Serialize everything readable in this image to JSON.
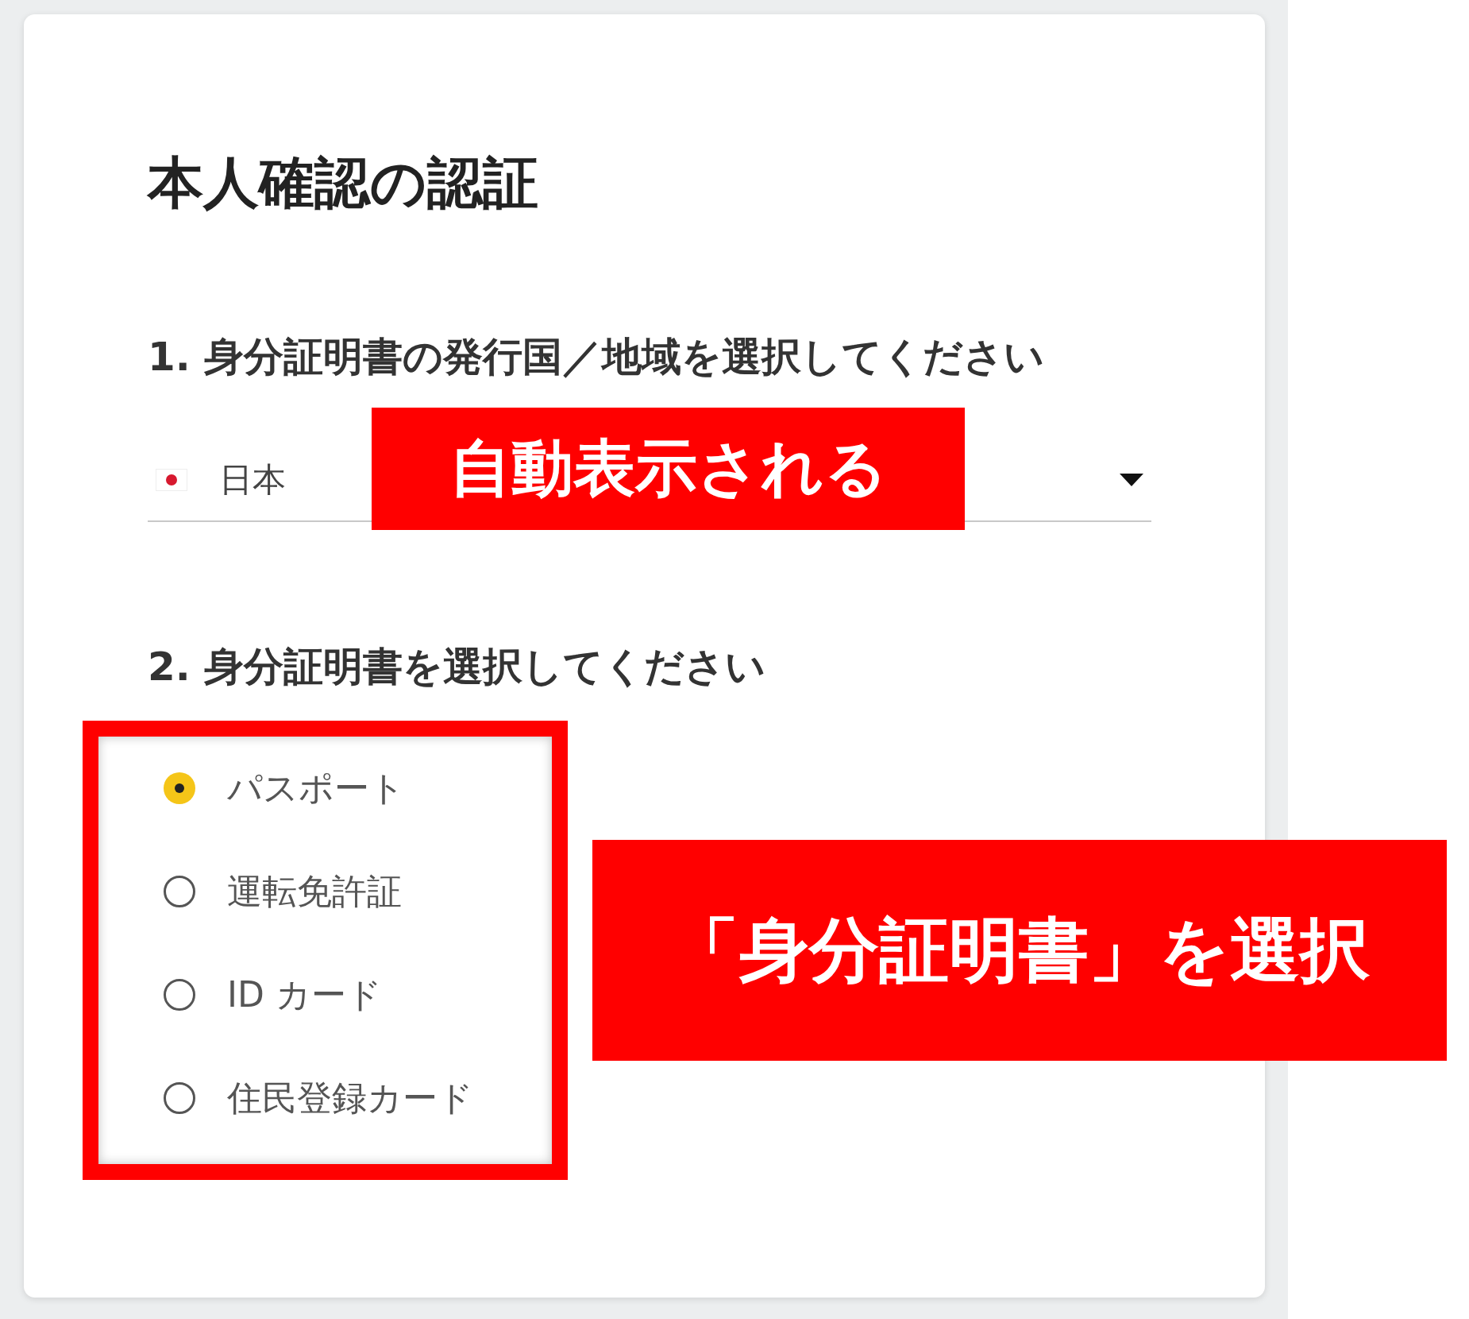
{
  "title": "本人確認の認証",
  "step1": {
    "label": "1. 身分証明書の発行国／地域を選択してください",
    "country": "日本"
  },
  "step2": {
    "label": "2. 身分証明書を選択してください",
    "options": [
      {
        "label": "パスポート",
        "selected": true
      },
      {
        "label": "運転免許証",
        "selected": false
      },
      {
        "label": "ID カード",
        "selected": false
      },
      {
        "label": "住民登録カード",
        "selected": false
      }
    ]
  },
  "annotations": [
    {
      "text": "自動表示される"
    },
    {
      "text": "「身分証明書」を選択"
    }
  ]
}
